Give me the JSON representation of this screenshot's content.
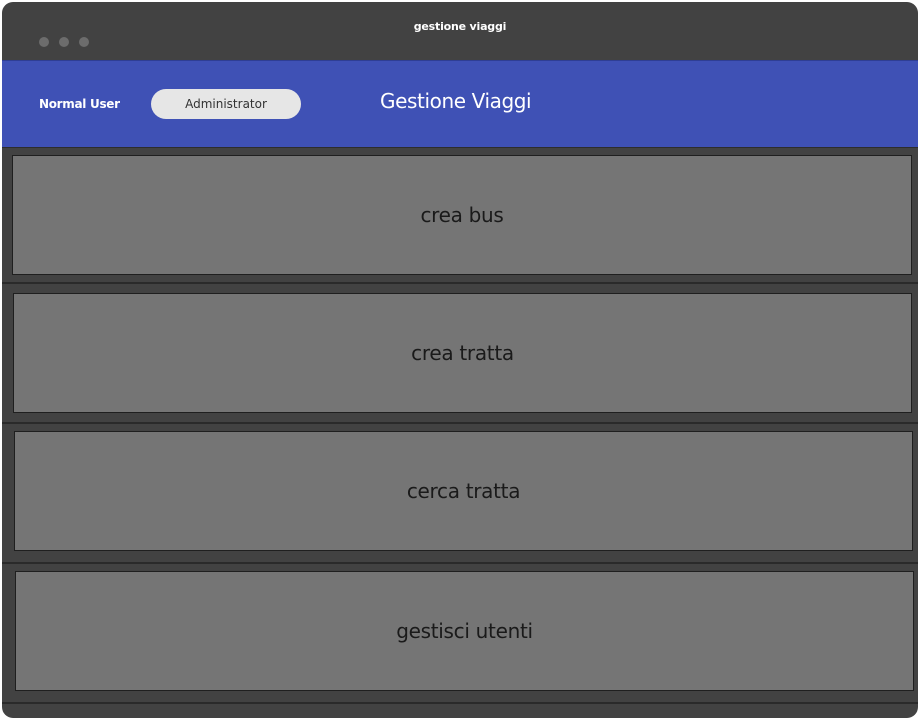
{
  "window": {
    "title": "gestione viaggi"
  },
  "header": {
    "user_label": "Normal User",
    "role_button": "Administrator",
    "title": "Gestione Viaggi"
  },
  "menu": {
    "items": [
      {
        "label": "crea bus"
      },
      {
        "label": "crea tratta"
      },
      {
        "label": "cerca tratta"
      },
      {
        "label": "gestisci utenti"
      }
    ]
  },
  "colors": {
    "window_bg": "#424242",
    "header_bg": "#3f51b5",
    "button_bg": "#757575",
    "pill_bg": "#e6e6e6"
  }
}
